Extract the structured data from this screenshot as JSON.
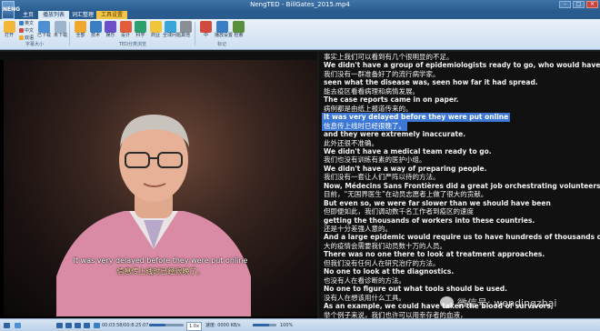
{
  "window": {
    "title": "NengTED - BillGates_2015.mp4",
    "app_icon_text": "NENG",
    "controls": [
      "–",
      "□",
      "×"
    ]
  },
  "ribbon_tabs": [
    "主页",
    "播放列表",
    "词汇整理",
    "工具设置"
  ],
  "ribbon": {
    "home": {
      "open": "打开",
      "en": "英文",
      "zh": "中文",
      "bilingual": "双语"
    },
    "groups": {
      "subtitle": "字幕大小",
      "library": "TED分类浏览",
      "mark": "标记"
    },
    "library_buttons": [
      {
        "label": "全部",
        "color": "#f0a92f"
      },
      {
        "label": "技术",
        "color": "#3a7fc4"
      },
      {
        "label": "娱乐",
        "color": "#6a4fc9"
      },
      {
        "label": "设计",
        "color": "#e25d3a"
      },
      {
        "label": "科学",
        "color": "#2d9f6e"
      },
      {
        "label": "商业",
        "color": "#f0c53a"
      },
      {
        "label": "全球问题",
        "color": "#3ba4d8"
      },
      {
        "label": "其他",
        "color": "#8a8f96"
      }
    ],
    "mark_buttons": [
      {
        "label": "中",
        "color": "#d14a3e"
      },
      {
        "label": "播放设置",
        "color": "#3a7fc4"
      },
      {
        "label": "检索",
        "color": "#5a8f3c"
      }
    ],
    "load_buttons": [
      "已下载",
      "未下载"
    ]
  },
  "video": {
    "subtitle_en": "It was very delayed before they were put online",
    "subtitle_cn": "信息传上线时已经很晚了。"
  },
  "transcript": [
    {
      "text": "事实上我们可以看到有几个很明显的不足。",
      "lang": "cn"
    },
    {
      "text": "We didn't have a group of epidemiologists  ready to go, who would have gone,",
      "lang": "en"
    },
    {
      "text": "我们没有一群准备好了的流行病学家。",
      "lang": "cn"
    },
    {
      "text": "seen what the disease was, seen how far it had spread.",
      "lang": "en"
    },
    {
      "text": "能去疫区看看病理和病情发展。",
      "lang": "cn"
    },
    {
      "text": "The case reports came in on paper.",
      "lang": "en"
    },
    {
      "text": "病例都是由纸上报道传来的。",
      "lang": "cn"
    },
    {
      "text": "It was very delayed before they were put online",
      "lang": "en",
      "highlight": true
    },
    {
      "text": "信息传上线时已经很晚了。",
      "lang": "cn",
      "highlight": true
    },
    {
      "text": "and they were extremely inaccurate.",
      "lang": "en"
    },
    {
      "text": "此外还很不准确。",
      "lang": "cn"
    },
    {
      "text": "We didn't have a medical team ready to go.",
      "lang": "en"
    },
    {
      "text": "我们也没有训练有素的医护小组。",
      "lang": "cn"
    },
    {
      "text": "We didn't have a way of preparing people.",
      "lang": "en"
    },
    {
      "text": "我们没有一套让人们严阵以待的方法。",
      "lang": "cn"
    },
    {
      "text": "Now, Médecins Sans Frontières  did a great job orchestrating volunteers.",
      "lang": "en"
    },
    {
      "text": "目前，“无国界医生”在动员志愿者上做了很大的贡献。",
      "lang": "cn"
    },
    {
      "text": "But even so, we were far slower than we should have been",
      "lang": "en"
    },
    {
      "text": "但即便如此，我们调动数千名工作者到疫区的速度",
      "lang": "cn"
    },
    {
      "text": "getting the thousands of workers into these countries.",
      "lang": "en"
    },
    {
      "text": "还是十分差强人意的。",
      "lang": "cn"
    },
    {
      "text": "And a large epidemic would require us to have hundreds of thousands of workers.",
      "lang": "en"
    },
    {
      "text": "大的疫情会需要我们动员数十万的人员。",
      "lang": "cn"
    },
    {
      "text": "There was no one there  to look at treatment approaches.",
      "lang": "en"
    },
    {
      "text": "但我们没有任何人在研究治疗的方法。",
      "lang": "cn"
    },
    {
      "text": "No one to look at the diagnostics.",
      "lang": "en"
    },
    {
      "text": "也没有人在看诊断的方法。",
      "lang": "cn"
    },
    {
      "text": "No one to figure out  what tools should be used.",
      "lang": "en"
    },
    {
      "text": "没有人在想该用什么工具。",
      "lang": "cn"
    },
    {
      "text": "As an example, we could have taken the blood of survivors,",
      "lang": "en"
    },
    {
      "text": "举个例子来说，我们也许可以用幸存者的血液，",
      "lang": "cn"
    },
    {
      "text": "processed it, and put that plasma back in people to protect them.",
      "lang": "en"
    }
  ],
  "watermark": "微信号: wendingzhai",
  "status": {
    "time": "00:03:58/00:8:25:07",
    "speed": "1.0x",
    "rate_label": "速度: 0000 KB/s",
    "zoom": "100%",
    "progress": 0.47,
    "volume": 0.7
  },
  "colors": {
    "highlight": "#3d78d6",
    "ribbon_active": "#dbe8f6",
    "title_bar": "#2c5f92"
  }
}
